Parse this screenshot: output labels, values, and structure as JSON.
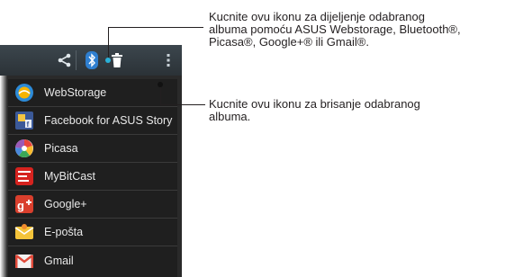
{
  "callouts": {
    "share": {
      "line1": "Kucnite ovu ikonu za dijeljenje odabranog",
      "line2": "albuma pomoću ASUS Webstorage, Bluetooth®,",
      "line3": "Picasa®, Google+® ili Gmail®."
    },
    "delete": {
      "line1": "Kucnite ovu ikonu za brisanje odabranog",
      "line2": "albuma."
    }
  },
  "action_bar": {
    "icons": [
      "share-icon",
      "bluetooth-icon",
      "trash-icon",
      "overflow-menu-icon"
    ]
  },
  "share_menu": {
    "items": [
      {
        "label": "WebStorage",
        "icon": "webstorage-icon",
        "color": "#f7b400"
      },
      {
        "label": "Facebook for ASUS Story",
        "icon": "facebook-story-icon",
        "color": "#3b5998"
      },
      {
        "label": "Picasa",
        "icon": "picasa-icon",
        "color": "#e8453c"
      },
      {
        "label": "MyBitCast",
        "icon": "mybitcast-icon",
        "color": "#d6231f"
      },
      {
        "label": "Google+",
        "icon": "google-plus-icon",
        "color": "#d93f2d"
      },
      {
        "label": "E-pošta",
        "icon": "email-icon",
        "color": "#f5c43a"
      },
      {
        "label": "Gmail",
        "icon": "gmail-icon",
        "color": "#e04a3a"
      }
    ]
  }
}
